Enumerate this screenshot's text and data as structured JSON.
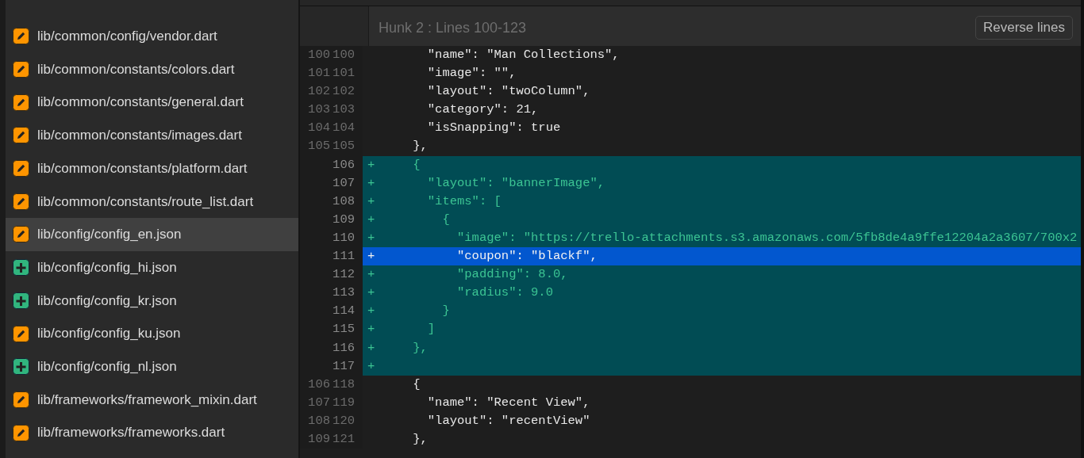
{
  "sidebar": {
    "items": [
      {
        "path": "lib/common/config/vendor.dart",
        "kind": "modified",
        "selected": false
      },
      {
        "path": "lib/common/constants/colors.dart",
        "kind": "modified",
        "selected": false
      },
      {
        "path": "lib/common/constants/general.dart",
        "kind": "modified",
        "selected": false
      },
      {
        "path": "lib/common/constants/images.dart",
        "kind": "modified",
        "selected": false
      },
      {
        "path": "lib/common/constants/platform.dart",
        "kind": "modified",
        "selected": false
      },
      {
        "path": "lib/common/constants/route_list.dart",
        "kind": "modified",
        "selected": false
      },
      {
        "path": "lib/config/config_en.json",
        "kind": "modified",
        "selected": true
      },
      {
        "path": "lib/config/config_hi.json",
        "kind": "added",
        "selected": false
      },
      {
        "path": "lib/config/config_kr.json",
        "kind": "added",
        "selected": false
      },
      {
        "path": "lib/config/config_ku.json",
        "kind": "modified",
        "selected": false
      },
      {
        "path": "lib/config/config_nl.json",
        "kind": "added",
        "selected": false
      },
      {
        "path": "lib/frameworks/framework_mixin.dart",
        "kind": "modified",
        "selected": false
      },
      {
        "path": "lib/frameworks/frameworks.dart",
        "kind": "modified",
        "selected": false
      }
    ]
  },
  "hunk": {
    "title": "Hunk 2 : Lines 100-123",
    "button": "Reverse lines",
    "lines": [
      {
        "old": "100",
        "new": "100",
        "kind": "context",
        "text": "      \"name\": \"Man Collections\",",
        "selected": false
      },
      {
        "old": "101",
        "new": "101",
        "kind": "context",
        "text": "      \"image\": \"\",",
        "selected": false
      },
      {
        "old": "102",
        "new": "102",
        "kind": "context",
        "text": "      \"layout\": \"twoColumn\",",
        "selected": false
      },
      {
        "old": "103",
        "new": "103",
        "kind": "context",
        "text": "      \"category\": 21,",
        "selected": false
      },
      {
        "old": "104",
        "new": "104",
        "kind": "context",
        "text": "      \"isSnapping\": true",
        "selected": false
      },
      {
        "old": "105",
        "new": "105",
        "kind": "context",
        "text": "    },",
        "selected": false
      },
      {
        "new": "106",
        "kind": "added",
        "marker": "+",
        "text": "    {",
        "selected": false
      },
      {
        "new": "107",
        "kind": "added",
        "marker": "+",
        "text": "      \"layout\": \"bannerImage\",",
        "selected": false
      },
      {
        "new": "108",
        "kind": "added",
        "marker": "+",
        "text": "      \"items\": [",
        "selected": false
      },
      {
        "new": "109",
        "kind": "added",
        "marker": "+",
        "text": "        {",
        "selected": false
      },
      {
        "new": "110",
        "kind": "added",
        "marker": "+",
        "text": "          \"image\": \"https://trello-attachments.s3.amazonaws.com/5fb8de4a9ffe12204a2a3607/700x2",
        "selected": false
      },
      {
        "new": "111",
        "kind": "added",
        "marker": "+",
        "text": "          \"coupon\": \"blackf\",",
        "selected": true
      },
      {
        "new": "112",
        "kind": "added",
        "marker": "+",
        "text": "          \"padding\": 8.0,",
        "selected": false
      },
      {
        "new": "113",
        "kind": "added",
        "marker": "+",
        "text": "          \"radius\": 9.0",
        "selected": false
      },
      {
        "new": "114",
        "kind": "added",
        "marker": "+",
        "text": "        }",
        "selected": false
      },
      {
        "new": "115",
        "kind": "added",
        "marker": "+",
        "text": "      ]",
        "selected": false
      },
      {
        "new": "116",
        "kind": "added",
        "marker": "+",
        "text": "    },",
        "selected": false
      },
      {
        "new": "117",
        "kind": "added",
        "marker": "+",
        "selected": false
      },
      {
        "old": "106",
        "new": "118",
        "kind": "context",
        "text": "    {",
        "selected": false
      },
      {
        "old": "107",
        "new": "119",
        "kind": "context",
        "text": "      \"name\": \"Recent View\",",
        "selected": false
      },
      {
        "old": "108",
        "new": "120",
        "kind": "context",
        "text": "      \"layout\": \"recentView\"",
        "selected": false
      },
      {
        "old": "109",
        "new": "121",
        "kind": "context",
        "text": "    },",
        "selected": false
      }
    ]
  }
}
